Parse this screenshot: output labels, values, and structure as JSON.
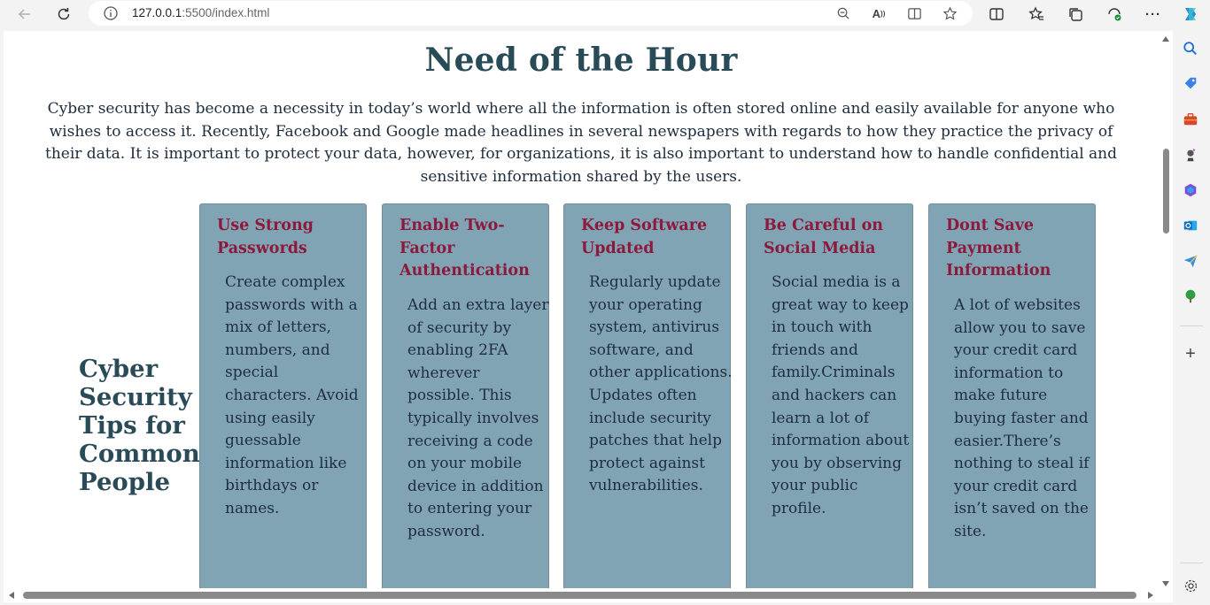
{
  "browser": {
    "url_host": "127.0.0.1",
    "url_rest": ":5500/index.html"
  },
  "page": {
    "heading": "Need of the Hour",
    "intro": "Cyber security has become a necessity in today’s world where all the information is often stored online and easily available for anyone who wishes to access it. Recently, Facebook and Google made headlines in several newspapers with regards to how they practice the privacy of their data. It is important to protect your data, however, for organizations, it is also important to understand how to handle confidential and sensitive information shared by the users.",
    "side_title_lines": [
      "Cyber",
      "Security",
      "Tips for",
      "Common",
      "People"
    ],
    "cards": [
      {
        "title": "Use Strong Passwords",
        "text": "Create complex passwords with a mix of letters, numbers, and special characters. Avoid using easily guessable information like birthdays or names."
      },
      {
        "title": "Enable Two-Factor Authentication",
        "text": "Add an extra layer of security by enabling 2FA wherever possible. This typically involves receiving a code on your mobile device in addition to entering your password."
      },
      {
        "title": "Keep Software Updated",
        "text": "Regularly update your operating system, antivirus software, and other applications. Updates often include security patches that help protect against vulnerabilities."
      },
      {
        "title": "Be Careful on Social Media",
        "text": "Social media is a great way to keep in touch with friends and family.Criminals and hackers can learn a lot of information about you by observing your public profile."
      },
      {
        "title": "Dont Save Payment Information",
        "text": "A lot of websites allow you to save your credit card information to make future buying faster and easier.There’s nothing to steal if your credit card isn’t saved on the site."
      }
    ]
  },
  "colors": {
    "heading": "#284b57",
    "card_bg": "#81a4b4",
    "card_title": "#8b1a3c",
    "body_text": "#1e2d3d"
  },
  "icons": {
    "toolbar": [
      "back-icon",
      "refresh-icon",
      "info-icon",
      "zoom-out-icon",
      "read-aloud-icon",
      "immersive-reader-icon",
      "favorite-star-icon",
      "split-screen-icon",
      "favorites-icon",
      "collections-icon",
      "performance-icon",
      "more-icon",
      "copilot-icon"
    ],
    "sidebar": [
      "search-icon",
      "shopping-icon",
      "tools-icon",
      "games-icon",
      "microsoft365-icon",
      "outlook-icon",
      "send-icon",
      "tree-icon",
      "add-icon",
      "settings-icon"
    ]
  }
}
